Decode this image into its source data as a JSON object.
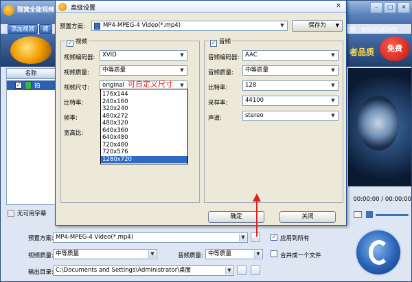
{
  "main": {
    "title": "狸窝全能视频",
    "menu": [
      "添加视频",
      "视"
    ],
    "menu_right": [
      "视频",
      "制作刻录DVD"
    ],
    "slogan": "者品质",
    "free_badge": "免费",
    "list_header": "名称",
    "file_name": "拍摄.mp",
    "subtitle": "无可用字幕",
    "time_readout": "00:00:00 / 00:00:00",
    "bottom": {
      "preset_label": "预置方案:",
      "preset_value": "MP4-MPEG-4 Video(*.mp4)",
      "apply_all": "应用到所有",
      "video_quality_label": "视频质量:",
      "video_quality_value": "中等质量",
      "audio_quality_label": "音频质量:",
      "audio_quality_value": "中等质量",
      "merge": "合并成一个文件",
      "output_label": "输出目录:",
      "output_value": "C:\\Documents and Settings\\Administrator\\桌面"
    }
  },
  "dialog": {
    "title": "高级设置",
    "close": "✕",
    "preset_label": "预置方案:",
    "preset_value": "MP4-MPEG-4 Video(*.mp4)",
    "save_as": "保存为",
    "video": {
      "group_label": "视频",
      "encoder_label": "视频编码器:",
      "encoder_value": "XVID",
      "quality_label": "视频质量:",
      "quality_value": "中等质量",
      "size_label": "视频尺寸:",
      "size_value": "original",
      "bitrate_label": "比特率:",
      "framerate_label": "帧率:",
      "aspect_label": "宽高比:",
      "size_annotation": "可自定义尺寸",
      "size_options": [
        "176x144",
        "240x160",
        "320x240",
        "480x272",
        "480x320",
        "640x360",
        "640x480",
        "720x480",
        "720x576",
        "1280x720"
      ],
      "size_selected_index": 9
    },
    "audio": {
      "group_label": "音频",
      "encoder_label": "音频编码器:",
      "encoder_value": "AAC",
      "quality_label": "音频质量:",
      "quality_value": "中等质量",
      "bitrate_label": "比特率:",
      "bitrate_value": "128",
      "samplerate_label": "采样率:",
      "samplerate_value": "44100",
      "channel_label": "声道:",
      "channel_value": "stereo"
    },
    "ok": "确定",
    "cancel": "关闭"
  },
  "colors": {
    "selection": "#316ac5",
    "annotation": "#e0201a",
    "title_bar": "#4a6fa8"
  }
}
